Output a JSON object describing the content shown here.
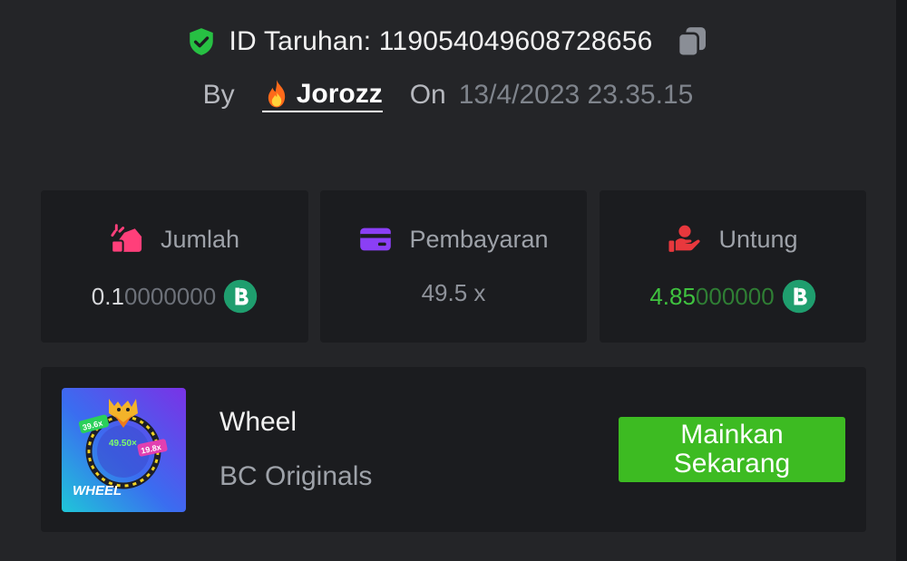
{
  "bet": {
    "label": "ID Taruhan: 119054049608728656"
  },
  "by_row": {
    "by_label": "By",
    "username": "Jorozz",
    "on_label": "On",
    "date": "13/4/2023 23.35.15"
  },
  "stats": [
    {
      "title": "Jumlah",
      "value_main": "0.1",
      "value_dim": "0000000",
      "icon": "bet-amount-icon"
    },
    {
      "title": "Pembayaran",
      "value_main": "49.5 x",
      "value_dim": "",
      "icon": "card-icon"
    },
    {
      "title": "Untung",
      "value_main": "4.85",
      "value_dim": "000000",
      "icon": "profit-hand-icon"
    }
  ],
  "game": {
    "name": "Wheel",
    "provider": "BC Originals",
    "play_label": "Mainkan Sekarang",
    "thumb": {
      "title": "WHEEL",
      "center": "49.50×",
      "left_tag": "39.6x",
      "right_tag": "19.8x"
    }
  },
  "colors": {
    "background": "#242528",
    "card": "#1b1c1f",
    "accent_green": "#3dbb22",
    "profit_green": "#3fc23f",
    "coin": "#1f9e6e"
  }
}
